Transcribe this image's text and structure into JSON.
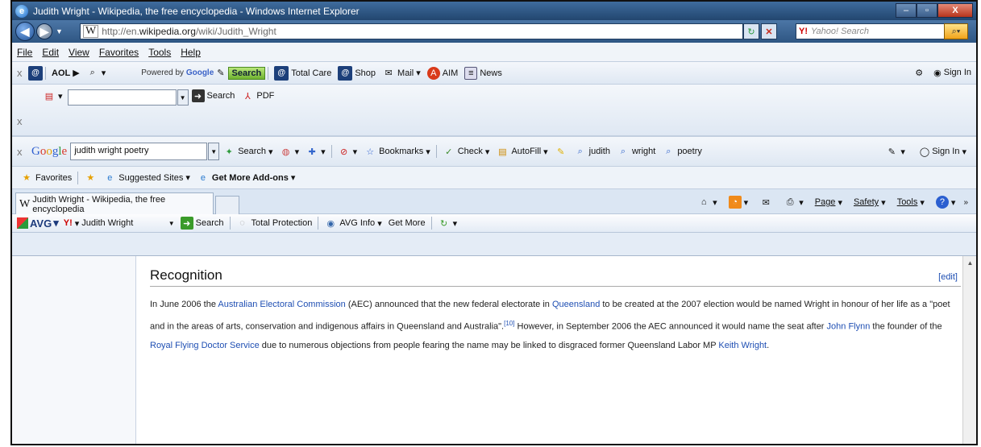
{
  "window": {
    "title": "Judith Wright - Wikipedia, the free encyclopedia - Windows Internet Explorer"
  },
  "address": {
    "prefix": "http://en.",
    "domain": "wikipedia.org",
    "path": "/wiki/Judith_Wright",
    "search_placeholder": "Yahoo! Search"
  },
  "menu": [
    "File",
    "Edit",
    "View",
    "Favorites",
    "Tools",
    "Help"
  ],
  "aol": {
    "logo": "AOL",
    "powered": "Powered by",
    "google": "Google",
    "search": "Search",
    "total_care": "Total Care",
    "shop": "Shop",
    "mail": "Mail",
    "aim": "AIM",
    "news": "News",
    "sign_in": "Sign In"
  },
  "pdfbar": {
    "search": "Search",
    "pdf": "PDF"
  },
  "googlebar": {
    "query": "judith wright poetry",
    "search": "Search",
    "bookmarks": "Bookmarks",
    "check": "Check",
    "autofill": "AutoFill",
    "terms": [
      "judith",
      "wright",
      "poetry"
    ],
    "sign_in": "Sign In"
  },
  "favbar": {
    "favorites": "Favorites",
    "suggested": "Suggested Sites",
    "addons": "Get More Add-ons"
  },
  "tab": {
    "title": "Judith Wright - Wikipedia, the free encyclopedia"
  },
  "cmdbar": {
    "page": "Page",
    "safety": "Safety",
    "tools": "Tools"
  },
  "avg": {
    "logo": "AVG",
    "query": "Judith Wright",
    "search": "Search",
    "total_protection": "Total Protection",
    "info": "AVG Info",
    "get_more": "Get More"
  },
  "article": {
    "heading": "Recognition",
    "edit": "[edit]",
    "p1": "In June 2006 the ",
    "l1": "Australian Electoral Commission",
    "p2": " (AEC) announced that the new federal electorate in ",
    "l2": "Queensland",
    "p3": " to be created at the 2007 election would be named Wright in honour of her life as a \"poet and in the areas of arts, conservation and indigenous affairs in Queensland and Australia\".",
    "ref": "[10]",
    "p4": " However, in September 2006 the AEC announced it would name the seat after ",
    "l3": "John Flynn",
    "p5": " the founder of the ",
    "l4": "Royal Flying Doctor Service",
    "p6": " due to numerous objections from people fearing the name may be linked to disgraced former Queensland Labor MP ",
    "l5": "Keith Wright",
    "p7": "."
  }
}
